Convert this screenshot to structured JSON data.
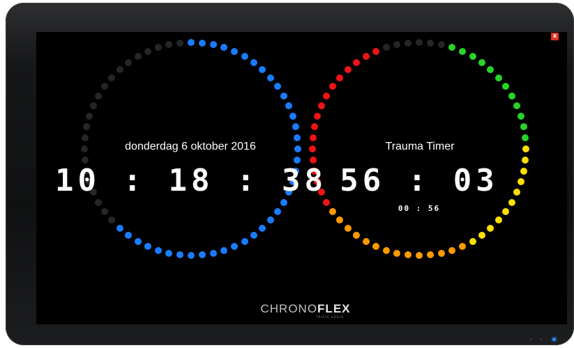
{
  "window": {
    "close_label": "x"
  },
  "clock": {
    "date": "donderdag 6 oktober 2016",
    "time": "10 : 18 : 38",
    "seconds_elapsed": 38
  },
  "timer": {
    "title": "Trauma Timer",
    "main": "56 : 03",
    "sub": "00 : 56"
  },
  "logo": {
    "chrono": "CHRONO",
    "flex": "FLEX",
    "tagline": "TRIPLE AUDIO"
  },
  "colors": {
    "clock_active": "#1a7cff",
    "clock_inactive": "#262626",
    "timer_green": "#27d427",
    "timer_yellow": "#ffe000",
    "timer_orange": "#ff9a00",
    "timer_red": "#ee1414",
    "timer_inactive": "#262626",
    "close_button": "#e0301e"
  },
  "icons": {
    "close": "close-icon",
    "power": "power-led-icon"
  }
}
